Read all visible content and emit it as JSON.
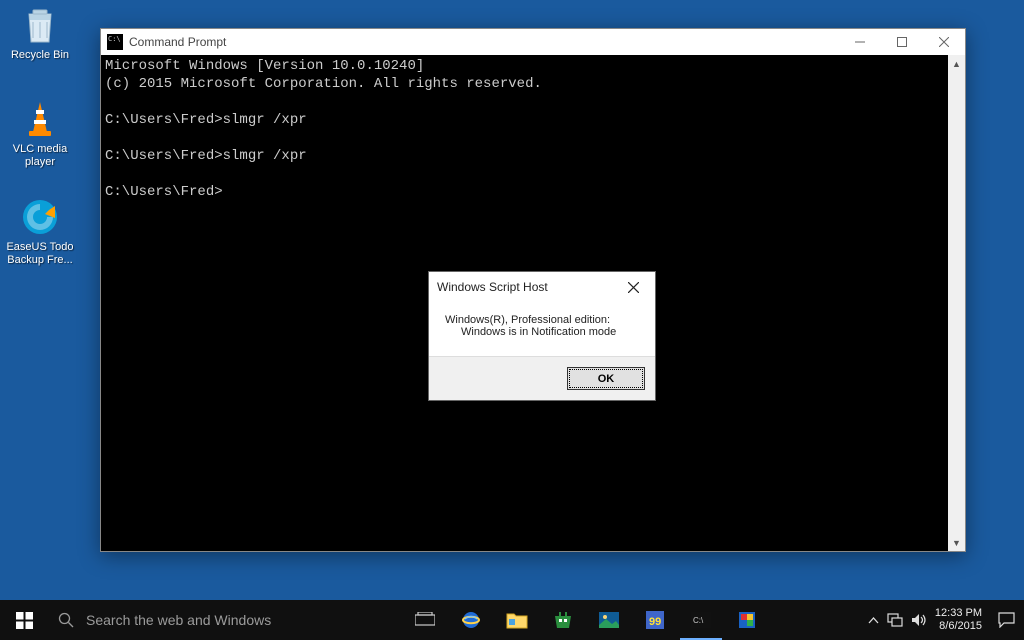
{
  "desktop": {
    "recycle_label": "Recycle Bin",
    "vlc_label": "VLC media player",
    "easeus_label": "EaseUS Todo Backup Fre..."
  },
  "cmd": {
    "title": "Command Prompt",
    "lines": "Microsoft Windows [Version 10.0.10240]\n(c) 2015 Microsoft Corporation. All rights reserved.\n\nC:\\Users\\Fred>slmgr /xpr\n\nC:\\Users\\Fred>slmgr /xpr\n\nC:\\Users\\Fred>"
  },
  "dialog": {
    "title": "Windows Script Host",
    "line1": "Windows(R), Professional edition:",
    "line2": "Windows is in Notification mode",
    "ok_label": "OK"
  },
  "taskbar": {
    "search_placeholder": "Search the web and Windows",
    "time": "12:33 PM",
    "date": "8/6/2015"
  }
}
